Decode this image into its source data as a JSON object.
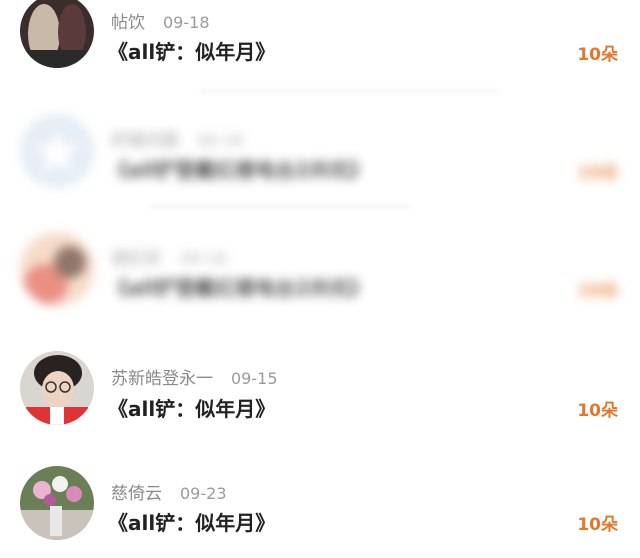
{
  "comments": [
    {
      "name": "帖饮",
      "date": "09-18",
      "title": "《all铲：似年月》",
      "gift": "10朵",
      "blurred": false,
      "avatar_colors": [
        "#3a2e2c",
        "#c8b9a8"
      ]
    },
    {
      "name": "轩辕问题",
      "date": "09-16",
      "title": "《all铲登戴红楼电台2共坑》",
      "gift": "10朵",
      "blurred": true,
      "avatar_colors": [
        "#dde7f3",
        "#b9cbe4"
      ]
    },
    {
      "name": "谢红彩",
      "date": "09-16",
      "title": "《all铲登戴红楼电台2共坑》",
      "gift": "10朵",
      "blurred": true,
      "avatar_colors": [
        "#e46a5a",
        "#f3d0b8"
      ]
    },
    {
      "name": "苏新皓登永一",
      "date": "09-15",
      "title": "《all铲：似年月》",
      "gift": "10朵",
      "blurred": false,
      "avatar_colors": [
        "#2a2220",
        "#e03434"
      ]
    },
    {
      "name": "慈倚云",
      "date": "09-23",
      "title": "《all铲：似年月》",
      "gift": "10朵",
      "blurred": false,
      "avatar_colors": [
        "#6a7f55",
        "#e9b4d4"
      ]
    }
  ]
}
